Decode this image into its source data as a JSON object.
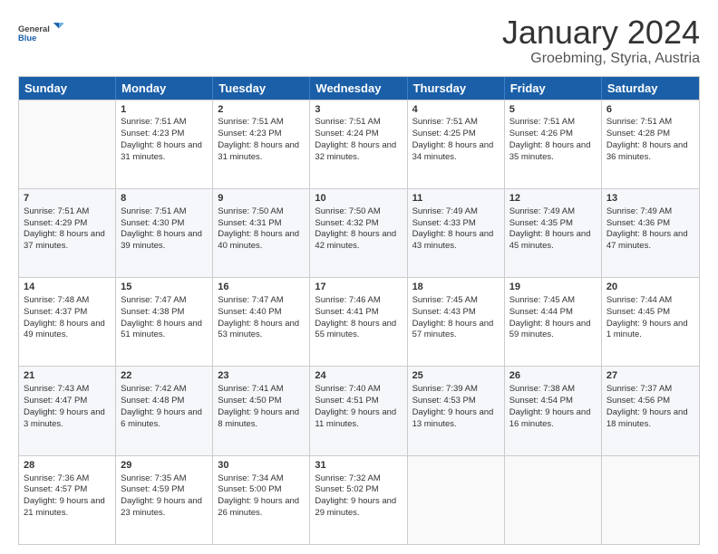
{
  "logo": {
    "text_general": "General",
    "text_blue": "Blue"
  },
  "header": {
    "month": "January 2024",
    "location": "Groebming, Styria, Austria"
  },
  "days": [
    "Sunday",
    "Monday",
    "Tuesday",
    "Wednesday",
    "Thursday",
    "Friday",
    "Saturday"
  ],
  "weeks": [
    [
      {
        "day": "",
        "sunrise": "",
        "sunset": "",
        "daylight": ""
      },
      {
        "day": "1",
        "sunrise": "Sunrise: 7:51 AM",
        "sunset": "Sunset: 4:23 PM",
        "daylight": "Daylight: 8 hours and 31 minutes."
      },
      {
        "day": "2",
        "sunrise": "Sunrise: 7:51 AM",
        "sunset": "Sunset: 4:23 PM",
        "daylight": "Daylight: 8 hours and 31 minutes."
      },
      {
        "day": "3",
        "sunrise": "Sunrise: 7:51 AM",
        "sunset": "Sunset: 4:24 PM",
        "daylight": "Daylight: 8 hours and 32 minutes."
      },
      {
        "day": "4",
        "sunrise": "Sunrise: 7:51 AM",
        "sunset": "Sunset: 4:25 PM",
        "daylight": "Daylight: 8 hours and 34 minutes."
      },
      {
        "day": "5",
        "sunrise": "Sunrise: 7:51 AM",
        "sunset": "Sunset: 4:26 PM",
        "daylight": "Daylight: 8 hours and 35 minutes."
      },
      {
        "day": "6",
        "sunrise": "Sunrise: 7:51 AM",
        "sunset": "Sunset: 4:28 PM",
        "daylight": "Daylight: 8 hours and 36 minutes."
      }
    ],
    [
      {
        "day": "7",
        "sunrise": "Sunrise: 7:51 AM",
        "sunset": "Sunset: 4:29 PM",
        "daylight": "Daylight: 8 hours and 37 minutes."
      },
      {
        "day": "8",
        "sunrise": "Sunrise: 7:51 AM",
        "sunset": "Sunset: 4:30 PM",
        "daylight": "Daylight: 8 hours and 39 minutes."
      },
      {
        "day": "9",
        "sunrise": "Sunrise: 7:50 AM",
        "sunset": "Sunset: 4:31 PM",
        "daylight": "Daylight: 8 hours and 40 minutes."
      },
      {
        "day": "10",
        "sunrise": "Sunrise: 7:50 AM",
        "sunset": "Sunset: 4:32 PM",
        "daylight": "Daylight: 8 hours and 42 minutes."
      },
      {
        "day": "11",
        "sunrise": "Sunrise: 7:49 AM",
        "sunset": "Sunset: 4:33 PM",
        "daylight": "Daylight: 8 hours and 43 minutes."
      },
      {
        "day": "12",
        "sunrise": "Sunrise: 7:49 AM",
        "sunset": "Sunset: 4:35 PM",
        "daylight": "Daylight: 8 hours and 45 minutes."
      },
      {
        "day": "13",
        "sunrise": "Sunrise: 7:49 AM",
        "sunset": "Sunset: 4:36 PM",
        "daylight": "Daylight: 8 hours and 47 minutes."
      }
    ],
    [
      {
        "day": "14",
        "sunrise": "Sunrise: 7:48 AM",
        "sunset": "Sunset: 4:37 PM",
        "daylight": "Daylight: 8 hours and 49 minutes."
      },
      {
        "day": "15",
        "sunrise": "Sunrise: 7:47 AM",
        "sunset": "Sunset: 4:38 PM",
        "daylight": "Daylight: 8 hours and 51 minutes."
      },
      {
        "day": "16",
        "sunrise": "Sunrise: 7:47 AM",
        "sunset": "Sunset: 4:40 PM",
        "daylight": "Daylight: 8 hours and 53 minutes."
      },
      {
        "day": "17",
        "sunrise": "Sunrise: 7:46 AM",
        "sunset": "Sunset: 4:41 PM",
        "daylight": "Daylight: 8 hours and 55 minutes."
      },
      {
        "day": "18",
        "sunrise": "Sunrise: 7:45 AM",
        "sunset": "Sunset: 4:43 PM",
        "daylight": "Daylight: 8 hours and 57 minutes."
      },
      {
        "day": "19",
        "sunrise": "Sunrise: 7:45 AM",
        "sunset": "Sunset: 4:44 PM",
        "daylight": "Daylight: 8 hours and 59 minutes."
      },
      {
        "day": "20",
        "sunrise": "Sunrise: 7:44 AM",
        "sunset": "Sunset: 4:45 PM",
        "daylight": "Daylight: 9 hours and 1 minute."
      }
    ],
    [
      {
        "day": "21",
        "sunrise": "Sunrise: 7:43 AM",
        "sunset": "Sunset: 4:47 PM",
        "daylight": "Daylight: 9 hours and 3 minutes."
      },
      {
        "day": "22",
        "sunrise": "Sunrise: 7:42 AM",
        "sunset": "Sunset: 4:48 PM",
        "daylight": "Daylight: 9 hours and 6 minutes."
      },
      {
        "day": "23",
        "sunrise": "Sunrise: 7:41 AM",
        "sunset": "Sunset: 4:50 PM",
        "daylight": "Daylight: 9 hours and 8 minutes."
      },
      {
        "day": "24",
        "sunrise": "Sunrise: 7:40 AM",
        "sunset": "Sunset: 4:51 PM",
        "daylight": "Daylight: 9 hours and 11 minutes."
      },
      {
        "day": "25",
        "sunrise": "Sunrise: 7:39 AM",
        "sunset": "Sunset: 4:53 PM",
        "daylight": "Daylight: 9 hours and 13 minutes."
      },
      {
        "day": "26",
        "sunrise": "Sunrise: 7:38 AM",
        "sunset": "Sunset: 4:54 PM",
        "daylight": "Daylight: 9 hours and 16 minutes."
      },
      {
        "day": "27",
        "sunrise": "Sunrise: 7:37 AM",
        "sunset": "Sunset: 4:56 PM",
        "daylight": "Daylight: 9 hours and 18 minutes."
      }
    ],
    [
      {
        "day": "28",
        "sunrise": "Sunrise: 7:36 AM",
        "sunset": "Sunset: 4:57 PM",
        "daylight": "Daylight: 9 hours and 21 minutes."
      },
      {
        "day": "29",
        "sunrise": "Sunrise: 7:35 AM",
        "sunset": "Sunset: 4:59 PM",
        "daylight": "Daylight: 9 hours and 23 minutes."
      },
      {
        "day": "30",
        "sunrise": "Sunrise: 7:34 AM",
        "sunset": "Sunset: 5:00 PM",
        "daylight": "Daylight: 9 hours and 26 minutes."
      },
      {
        "day": "31",
        "sunrise": "Sunrise: 7:32 AM",
        "sunset": "Sunset: 5:02 PM",
        "daylight": "Daylight: 9 hours and 29 minutes."
      },
      {
        "day": "",
        "sunrise": "",
        "sunset": "",
        "daylight": ""
      },
      {
        "day": "",
        "sunrise": "",
        "sunset": "",
        "daylight": ""
      },
      {
        "day": "",
        "sunrise": "",
        "sunset": "",
        "daylight": ""
      }
    ]
  ]
}
